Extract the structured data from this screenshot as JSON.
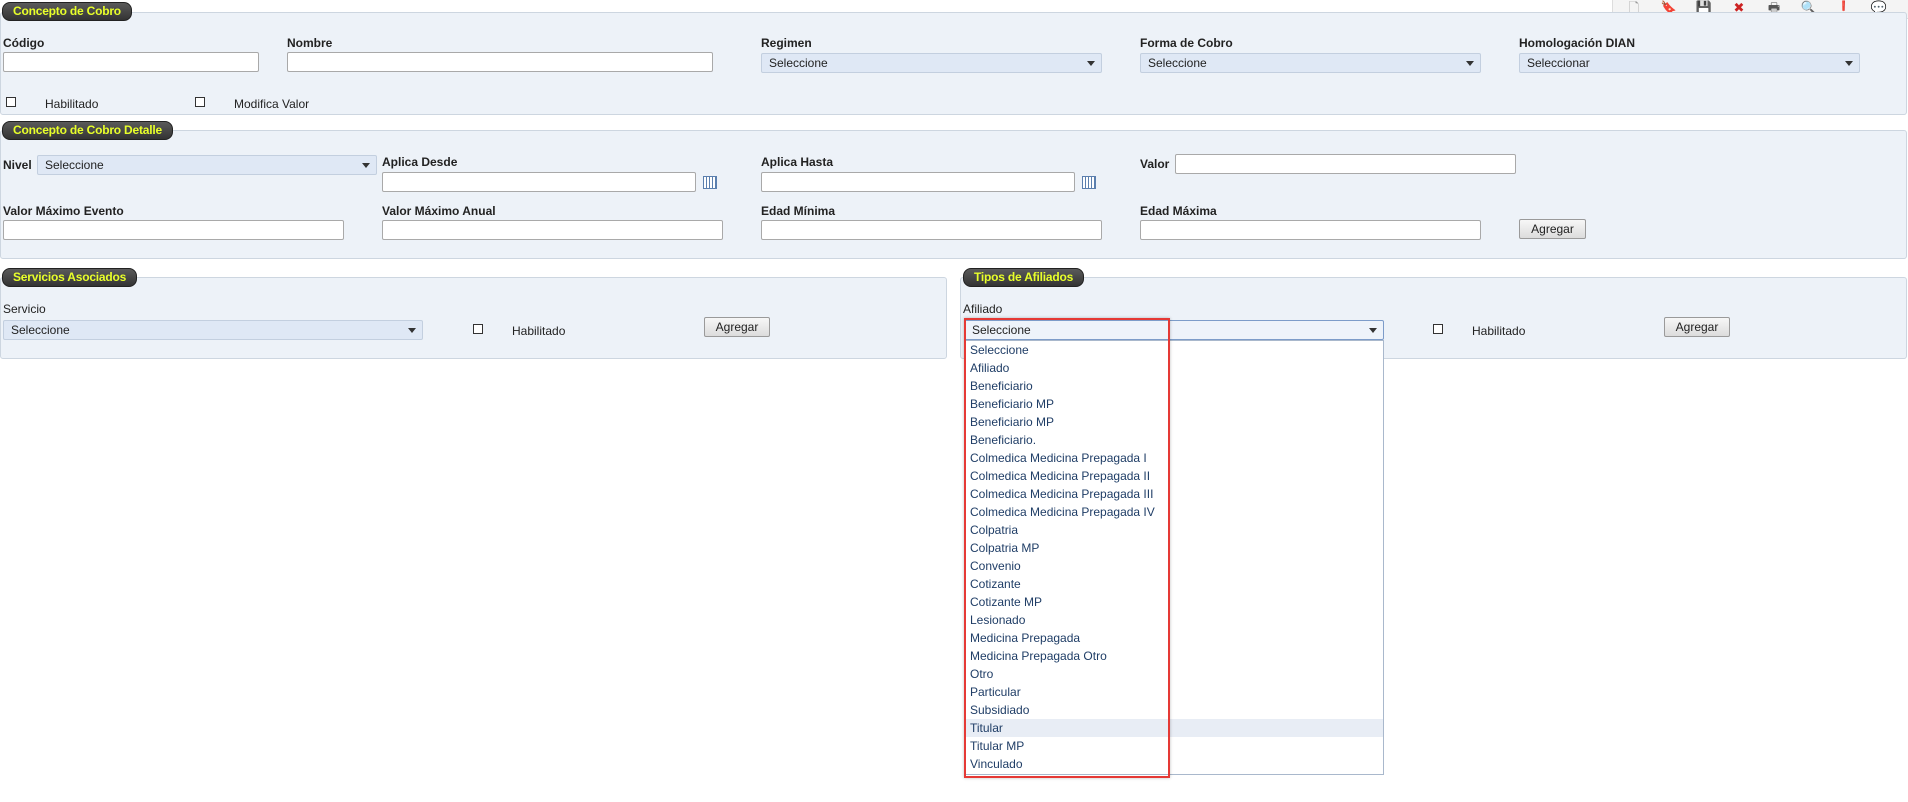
{
  "toolbar": {
    "icons": [
      "new-document-icon",
      "bookmark-icon",
      "save-icon",
      "delete-icon",
      "print-icon",
      "search-icon",
      "alert-icon",
      "comment-icon"
    ],
    "glyphs": [
      "🗋",
      "🔖",
      "💾",
      "✖",
      "🖶",
      "🔍",
      "❗",
      "💬"
    ],
    "colors": [
      "#999999",
      "#e0a31c",
      "#1f5fb0",
      "#cc2222",
      "#555555",
      "#3a6ea5",
      "#e02020",
      "#2a7fd4"
    ]
  },
  "concepto": {
    "legend": "Concepto de Cobro",
    "codigo_label": "Código",
    "nombre_label": "Nombre",
    "regimen_label": "Regimen",
    "regimen_value": "Seleccione",
    "forma_label": "Forma de Cobro",
    "forma_value": "Seleccione",
    "homologacion_label": "Homologación DIAN",
    "homologacion_value": "Seleccionar",
    "habilitado_label": "Habilitado",
    "modifica_label": "Modifica Valor"
  },
  "detalle": {
    "legend": "Concepto de Cobro Detalle",
    "nivel_label": "Nivel",
    "nivel_value": "Seleccione",
    "aplica_desde_label": "Aplica Desde",
    "aplica_hasta_label": "Aplica Hasta",
    "valor_label": "Valor",
    "valor_max_evento_label": "Valor Máximo Evento",
    "valor_max_anual_label": "Valor Máximo Anual",
    "edad_min_label": "Edad Mínima",
    "edad_max_label": "Edad Máxima",
    "agregar_label": "Agregar"
  },
  "servicios": {
    "legend": "Servicios Asociados",
    "servicio_label": "Servicio",
    "servicio_value": "Seleccione",
    "habilitado_label": "Habilitado",
    "agregar_label": "Agregar"
  },
  "tipos": {
    "legend": "Tipos de Afiliados",
    "afiliado_label": "Afiliado",
    "afiliado_value": "Seleccione",
    "habilitado_label": "Habilitado",
    "agregar_label": "Agregar",
    "options": [
      "Seleccione",
      "Afiliado",
      "Beneficiario",
      "Beneficiario MP",
      "Beneficiario MP",
      "Beneficiario.",
      "Colmedica Medicina Prepagada I",
      "Colmedica Medicina Prepagada II",
      "Colmedica Medicina Prepagada III",
      "Colmedica Medicina Prepagada IV",
      "Colpatria",
      "Colpatria MP",
      "Convenio",
      "Cotizante",
      "Cotizante MP",
      "Lesionado",
      "Medicina Prepagada",
      "Medicina Prepagada Otro",
      "Otro",
      "Particular",
      "Subsidiado",
      "Titular",
      "Titular MP",
      "Vinculado"
    ],
    "highlighted_option": "Titular"
  }
}
